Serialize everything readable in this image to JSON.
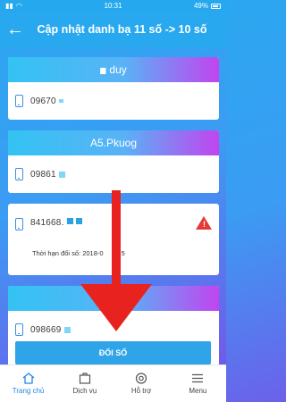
{
  "status_bar": {
    "time": "10:31",
    "battery": "49%"
  },
  "header": {
    "title": "Cập nhật danh bạ 11 số -> 10 số"
  },
  "cards": [
    {
      "name": "duy",
      "number": "09670"
    },
    {
      "name": "A5.Pkuog",
      "number": "09861"
    },
    {
      "number": "841668.",
      "expire_label": "Thời hạn đổi số: 2018-0",
      "expire_tail": "5"
    },
    {
      "name": "A",
      "number": "098669"
    }
  ],
  "action_button": {
    "label": "ĐỔI SỐ"
  },
  "bottom_nav": [
    {
      "label": "Trang chủ",
      "icon": "home-icon"
    },
    {
      "label": "Dịch vụ",
      "icon": "services-icon"
    },
    {
      "label": "Hỗ trợ",
      "icon": "support-icon"
    },
    {
      "label": "Menu",
      "icon": "menu-icon"
    }
  ],
  "colors": {
    "accent": "#2fa4e8",
    "warning": "#e53935",
    "arrow": "#e8231f"
  }
}
